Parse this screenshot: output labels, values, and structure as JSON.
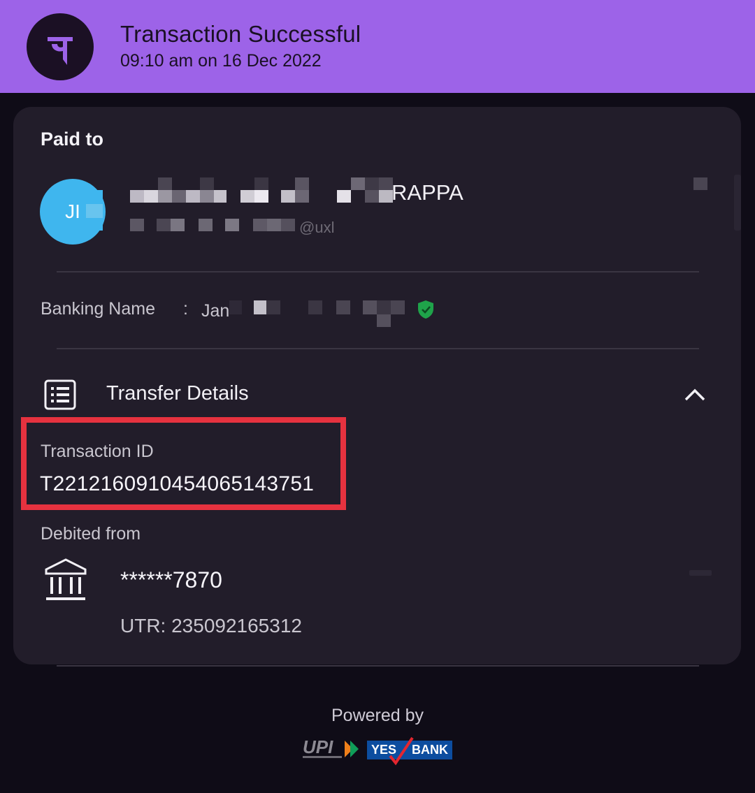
{
  "header": {
    "title": "Transaction Successful",
    "subtitle": "09:10 am on 16 Dec 2022",
    "logo_glyph": "पे",
    "background": "#9d63e8"
  },
  "card": {
    "paid_to_label": "Paid to",
    "avatar_initials": "JI",
    "avatar_color": "#3fb6ee",
    "payee_name_visible": "RAPPA",
    "payee_upi_visible": "@uxl",
    "banking_name_label": "Banking Name",
    "banking_name_separator": ":",
    "banking_name_visible": "Jan",
    "verified_icon": "verified-shield-icon",
    "transfer_details_title": "Transfer Details",
    "transaction_id_label": "Transaction ID",
    "transaction_id": "T2212160910454065143751",
    "highlight_color": "#e6323f",
    "debited_from_label": "Debited from",
    "account_masked": "******7870",
    "utr": "UTR: 235092165312"
  },
  "footer": {
    "powered_by": "Powered by",
    "upi_text": "UPI",
    "yes_text": "YES",
    "bank_text": "BANK"
  }
}
